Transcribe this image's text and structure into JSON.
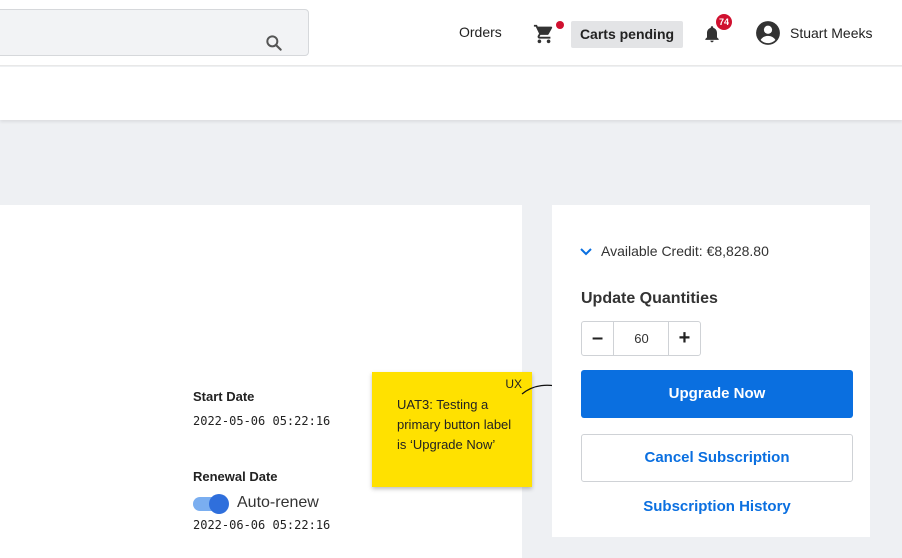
{
  "header": {
    "search": {
      "placeholder": "",
      "icon": "search-icon"
    },
    "nav": {
      "orders_label": "Orders",
      "cart_icon": "cart-icon",
      "carts_pending_label": "Carts pending",
      "notifications_icon": "bell-icon",
      "notifications_count": "74",
      "user_name": "Stuart Meeks"
    }
  },
  "details": {
    "start_date_label": "Start Date",
    "start_date_value": "2022-05-06 05:22:16",
    "renewal_date_label": "Renewal Date",
    "auto_renew_label": "Auto-renew",
    "auto_renew_on": true,
    "renewal_date_value": "2022-06-06 05:22:16"
  },
  "sticky_note": {
    "tag": "UX",
    "text": "UAT3: Testing a primary button label is ‘Upgrade Now’"
  },
  "sidebar": {
    "credit_text": "Available Credit: €8,828.80",
    "update_title": "Update Quantities",
    "quantity": "60",
    "minus_label": "–",
    "plus_label": "+",
    "upgrade_label": "Upgrade Now",
    "cancel_label": "Cancel Subscription",
    "history_label": "Subscription History"
  },
  "colors": {
    "primary": "#0a6fe0",
    "badge": "#d0102f",
    "sticky": "#ffe100",
    "toggle": "#2f6fdc"
  }
}
